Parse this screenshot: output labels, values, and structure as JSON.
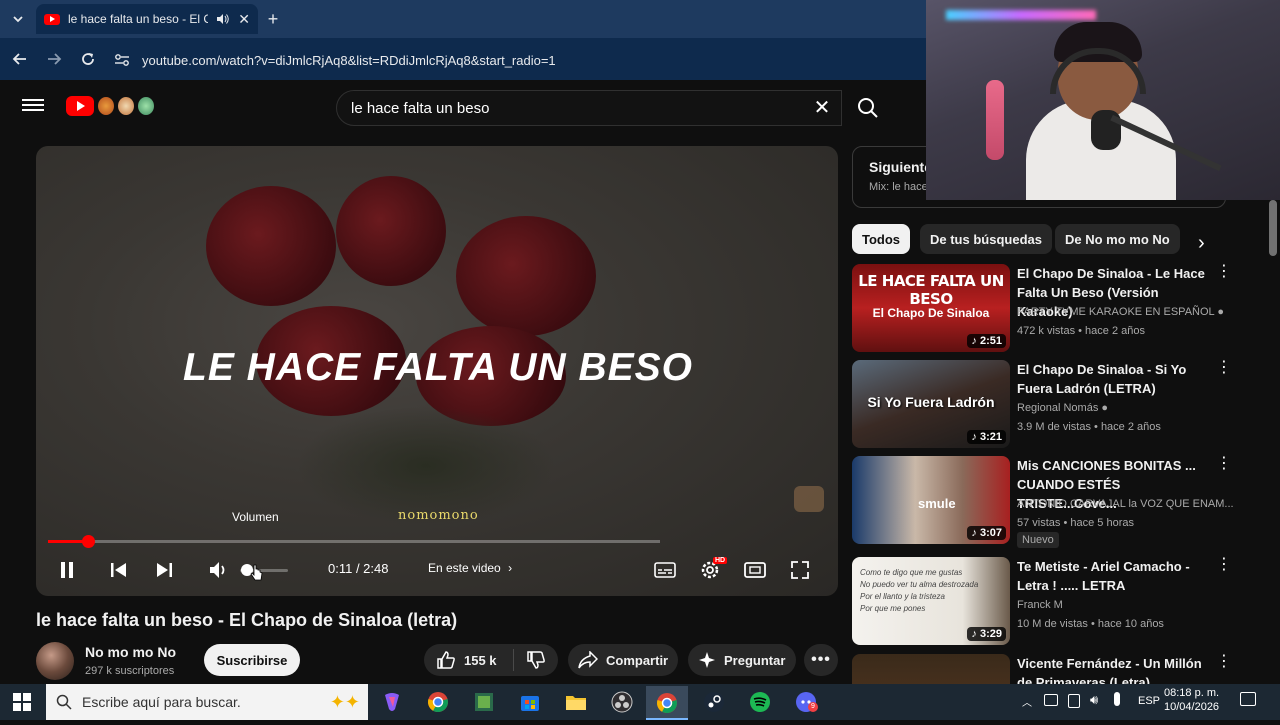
{
  "browser": {
    "tab_title": "le hace falta un beso - El Ch",
    "url": "youtube.com/watch?v=diJmlcRjAq8&list=RDdiJmlcRjAq8&start_radio=1"
  },
  "youtube": {
    "search_query": "le hace falta un beso"
  },
  "player": {
    "overlay_text": "LE HACE FALTA UN BESO",
    "watermark": "nomomono",
    "volume_tooltip": "Volumen",
    "current_time": "0:11",
    "duration": "2:48",
    "time_display": "0:11 / 2:48",
    "chapters_label": "En este video",
    "progress": 0.065,
    "volume": 0.1
  },
  "video": {
    "title": "le hace falta un beso - El Chapo de Sinaloa (letra)",
    "channel": "No mo mo No",
    "subscribers": "297 k suscriptores",
    "subscribe_label": "Suscribirse",
    "likes": "155 k",
    "share_label": "Compartir",
    "ask_label": "Preguntar"
  },
  "sidebar": {
    "next_title": "Siguiente",
    "next_sub": "Mix: le hace",
    "chips": [
      "Todos",
      "De tus búsquedas",
      "De No mo mo No"
    ],
    "recommendations": [
      {
        "title": "El Chapo De Sinaloa - Le Hace Falta Un Beso (Versión Karaoke)",
        "channel": "PARTY TYME KARAOKE EN ESPAÑOL",
        "meta": "472 k vistas • hace 2 años",
        "duration": "2:51",
        "thumb_text_1": "LE HACE FALTA UN BESO",
        "thumb_text_2": "El Chapo De Sinaloa"
      },
      {
        "title": "El Chapo De Sinaloa - Si Yo Fuera Ladrón (LETRA)",
        "channel": "Regional Nomás",
        "meta": "3.9 M de vistas • hace 2 años",
        "duration": "3:21",
        "thumb_text_1": "Si Yo Fuera Ladrón"
      },
      {
        "title": "Mis CANCIONES BONITAS ... CUANDO ESTÉS TRISTE...Cove...",
        "channel": "ANTONIO CARVAJAL la VOZ QUE ENAM...",
        "meta": "57 vistas • hace 5 horas",
        "duration": "3:07",
        "badge": "Nuevo",
        "thumb_text_1": "smule"
      },
      {
        "title": "Te Metiste - Ariel Camacho - Letra ! ..... LETRA",
        "channel": "Franck M",
        "meta": "10 M de vistas • hace 10 años",
        "duration": "3:29",
        "thumb_lines": [
          "Como te digo que me gustas",
          "No puedo ver tu alma destrozada",
          "Por el llanto y la tristeza",
          "Por que me pones"
        ]
      },
      {
        "title": "Vicente Fernández - Un Millón de Primaveras (Letra)"
      }
    ]
  },
  "taskbar": {
    "search_placeholder": "Escribe aquí para buscar.",
    "language": "ESP",
    "time": "08:18 p. m.",
    "date": "10/04/2026"
  },
  "colors": {
    "yt_red": "#ff0000",
    "background": "#0f0f0f",
    "browser_frame": "#0e2a4d"
  }
}
